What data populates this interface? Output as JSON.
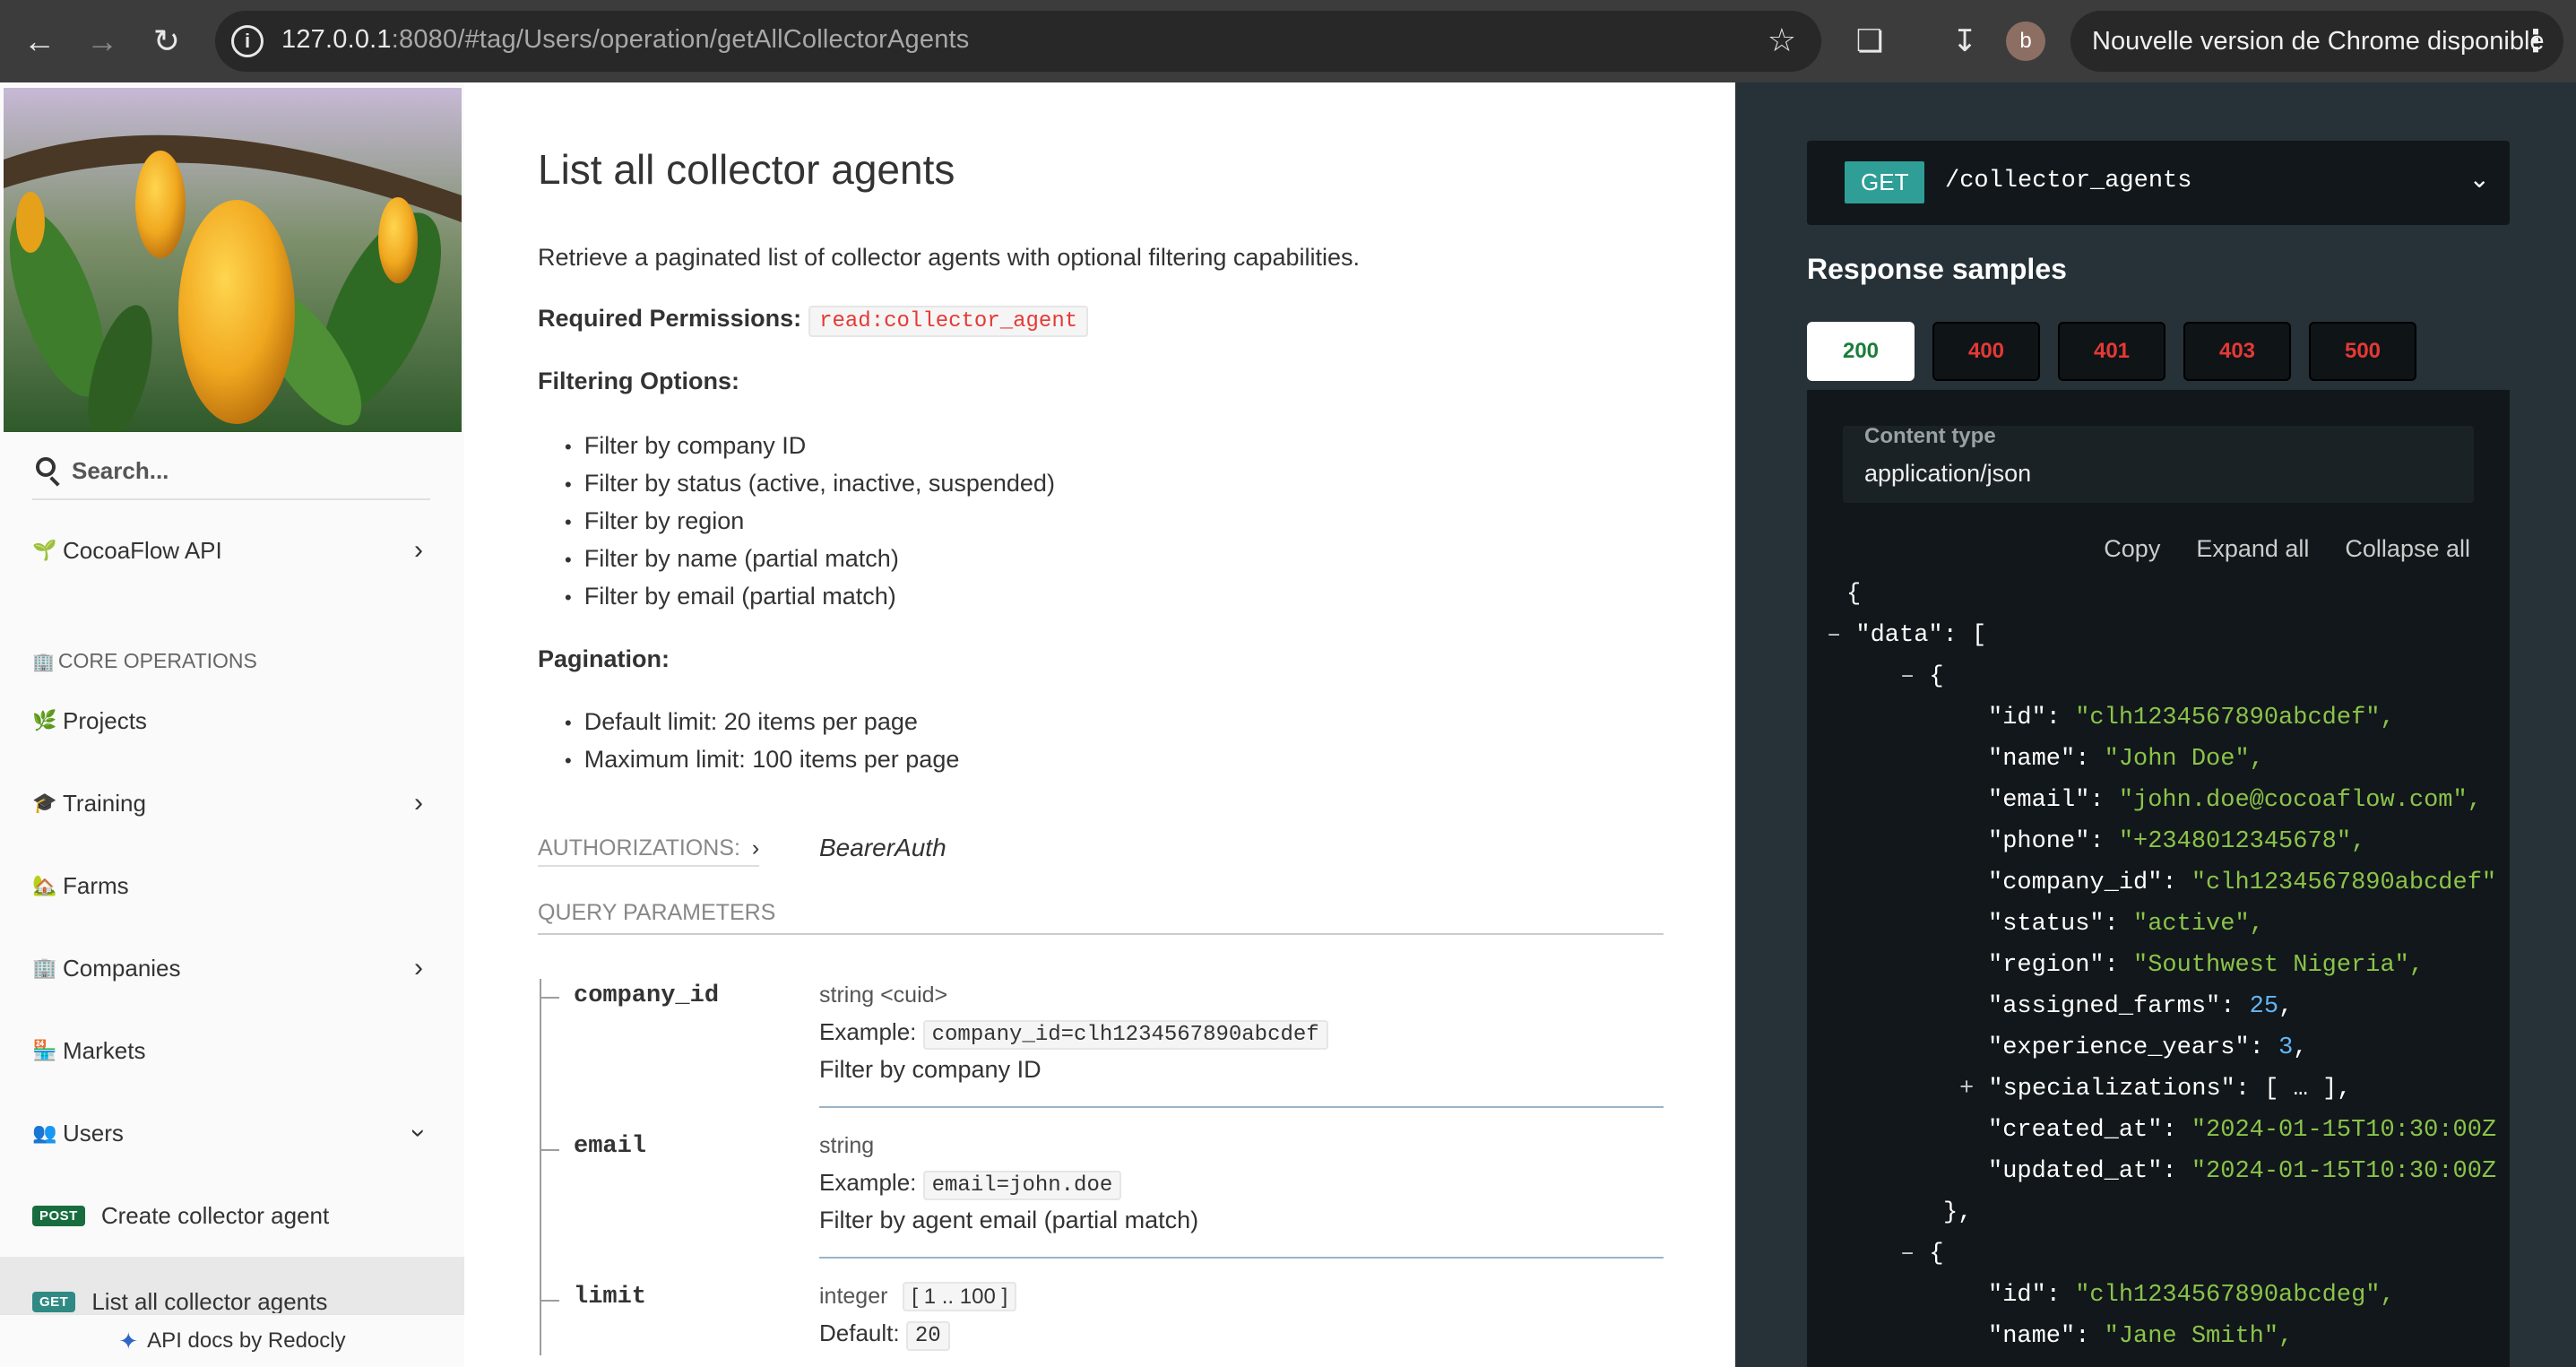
{
  "browser": {
    "url_host": "127.0.0.1",
    "url_rest": ":8080/#tag/Users/operation/getAllCollectorAgents",
    "profile_initial": "b",
    "update_label": "Nouvelle version de Chrome disponible"
  },
  "sidebar": {
    "search_placeholder": "Search...",
    "api_title": "CocoaFlow API",
    "section_label": "CORE OPERATIONS",
    "items": [
      {
        "label": "Projects",
        "icon": "leaf-icon"
      },
      {
        "label": "Training",
        "icon": "graduation-cap-icon"
      },
      {
        "label": "Farms",
        "icon": "farm-house-icon"
      },
      {
        "label": "Companies",
        "icon": "office-building-icon"
      },
      {
        "label": "Markets",
        "icon": "market-icon"
      },
      {
        "label": "Users",
        "icon": "users-icon"
      }
    ],
    "endpoints": [
      {
        "method": "POST",
        "label": "Create collector agent"
      },
      {
        "method": "GET",
        "label": "List all collector agents"
      }
    ],
    "footer": "API docs by Redocly"
  },
  "main": {
    "title": "List all collector agents",
    "description": "Retrieve a paginated list of collector agents with optional filtering capabilities.",
    "permissions_label": "Required Permissions:",
    "permissions_value": "read:collector_agent",
    "filtering_label": "Filtering Options:",
    "filtering": [
      "Filter by company ID",
      "Filter by status (active, inactive, suspended)",
      "Filter by region",
      "Filter by name (partial match)",
      "Filter by email (partial match)"
    ],
    "pagination_label": "Pagination:",
    "pagination": [
      "Default limit: 20 items per page",
      "Maximum limit: 100 items per page"
    ],
    "auth_label": "AUTHORIZATIONS:",
    "auth_value": "BearerAuth",
    "query_label": "QUERY PARAMETERS",
    "params": [
      {
        "name": "company_id",
        "type": "string <cuid>",
        "example_label": "Example:",
        "example": "company_id=clh1234567890abcdef",
        "desc": "Filter by company ID"
      },
      {
        "name": "email",
        "type": "string",
        "example_label": "Example:",
        "example": "email=john.doe",
        "desc": "Filter by agent email (partial match)"
      },
      {
        "name": "limit",
        "type": "integer",
        "range": "[ 1 .. 100 ]",
        "default_label": "Default:",
        "default": "20"
      }
    ]
  },
  "right": {
    "method": "GET",
    "path": "/collector_agents",
    "samples_title": "Response samples",
    "codes": [
      "200",
      "400",
      "401",
      "403",
      "500"
    ],
    "content_type_label": "Content type",
    "content_type": "application/json",
    "actions": [
      "Copy",
      "Expand all",
      "Collapse all"
    ],
    "colors": {
      "string": "#8bc34a",
      "number": "#64b5f6",
      "error_code": "#e53935",
      "ok_code": "#1b7d3a"
    },
    "json_lines": [
      "{",
      "\"data\": [",
      "{",
      "\"id\": ",
      "\"clh1234567890abcdef\",",
      "\"name\": ",
      "\"John Doe\",",
      "\"email\": ",
      "\"john.doe@cocoaflow.com\",",
      "\"phone\": ",
      "\"+2348012345678\",",
      "\"company_id\": ",
      "\"clh1234567890abcdef\"",
      "\"status\": ",
      "\"active\",",
      "\"region\": ",
      "\"Southwest Nigeria\",",
      "\"assigned_farms\": ",
      "25",
      "\"experience_years\": ",
      "3",
      "\"specializations\": [ … ],",
      "\"created_at\": ",
      "\"2024-01-15T10:30:00Z",
      "\"updated_at\": ",
      "\"2024-01-15T10:30:00Z",
      "},",
      "{",
      "\"id\": ",
      "\"clh1234567890abcdeg\",",
      "\"name\": ",
      "\"Jane Smith\","
    ]
  }
}
